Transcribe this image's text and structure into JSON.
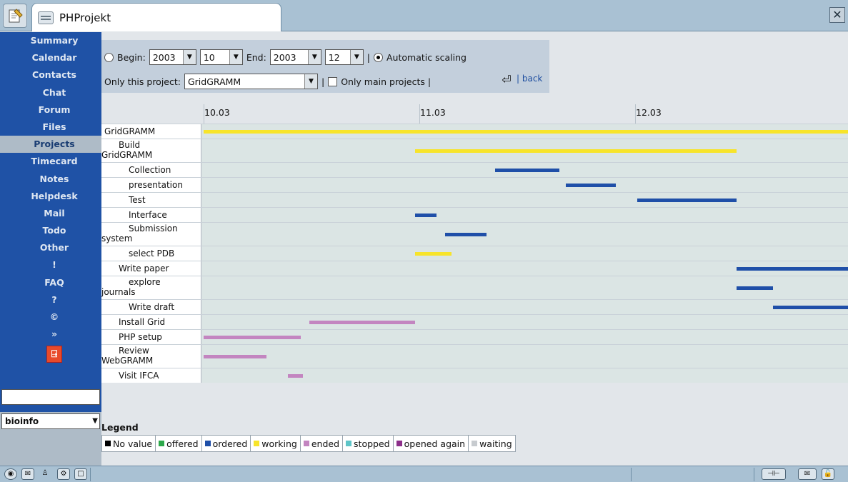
{
  "window": {
    "tab_title": "PHProjekt",
    "close_glyph": "✕"
  },
  "sidebar": {
    "items": [
      {
        "label": "Summary",
        "active": false
      },
      {
        "label": "Calendar",
        "active": false
      },
      {
        "label": "Contacts",
        "active": false
      },
      {
        "label": "Chat",
        "active": false
      },
      {
        "label": "Forum",
        "active": false
      },
      {
        "label": "Files",
        "active": false
      },
      {
        "label": "Projects",
        "active": true
      },
      {
        "label": "Timecard",
        "active": false
      },
      {
        "label": "Notes",
        "active": false
      },
      {
        "label": "Helpdesk",
        "active": false
      },
      {
        "label": "Mail",
        "active": false
      },
      {
        "label": "Todo",
        "active": false
      },
      {
        "label": "Other",
        "active": false
      },
      {
        "label": "!",
        "active": false
      },
      {
        "label": "FAQ",
        "active": false
      },
      {
        "label": "?",
        "active": false
      },
      {
        "label": "©",
        "active": false
      },
      {
        "label": "»",
        "active": false
      }
    ],
    "search_value": "",
    "group_select": "bioinfo"
  },
  "filter": {
    "begin_label": "Begin:",
    "begin_year": "2003",
    "begin_month": "10",
    "end_label": "End:",
    "end_year": "2003",
    "end_month": "12",
    "sep1": "|",
    "auto_scaling_label": "Automatic scaling",
    "auto_scaling_selected": true,
    "project_label": "Only this project:",
    "project_value": "GridGRAMM",
    "sep2": "|",
    "main_only_label": "Only main projects |",
    "main_only_checked": false,
    "back_label": "| back"
  },
  "gantt": {
    "months": [
      "10.03",
      "11.03",
      "12.03"
    ],
    "rows": [
      {
        "name_lines": [
          "GridGRAMM"
        ],
        "indent": 0,
        "start": 0.0,
        "end": 3.0,
        "status": "working"
      },
      {
        "name_lines": [
          "Build",
          "GridGRAMM"
        ],
        "indent": 1,
        "start": 0.98,
        "end": 2.47,
        "status": "working"
      },
      {
        "name_lines": [
          "Collection"
        ],
        "indent": 2,
        "start": 1.35,
        "end": 1.65,
        "status": "ordered"
      },
      {
        "name_lines": [
          "presentation"
        ],
        "indent": 2,
        "start": 1.68,
        "end": 1.91,
        "status": "ordered"
      },
      {
        "name_lines": [
          "Test"
        ],
        "indent": 2,
        "start": 2.01,
        "end": 2.47,
        "status": "ordered"
      },
      {
        "name_lines": [
          "Interface"
        ],
        "indent": 2,
        "start": 0.98,
        "end": 1.08,
        "status": "ordered"
      },
      {
        "name_lines": [
          "Submission",
          "system"
        ],
        "indent": 2,
        "start": 1.12,
        "end": 1.31,
        "status": "ordered"
      },
      {
        "name_lines": [
          "select PDB"
        ],
        "indent": 2,
        "start": 0.98,
        "end": 1.15,
        "status": "working"
      },
      {
        "name_lines": [
          "Write paper"
        ],
        "indent": 1,
        "start": 2.47,
        "end": 3.0,
        "status": "ordered"
      },
      {
        "name_lines": [
          "explore",
          "journals"
        ],
        "indent": 2,
        "start": 2.47,
        "end": 2.64,
        "status": "ordered"
      },
      {
        "name_lines": [
          "Write draft"
        ],
        "indent": 2,
        "start": 2.64,
        "end": 3.0,
        "status": "ordered"
      },
      {
        "name_lines": [
          "Install Grid"
        ],
        "indent": 1,
        "start": 0.49,
        "end": 0.98,
        "status": "ended"
      },
      {
        "name_lines": [
          "PHP setup"
        ],
        "indent": 1,
        "start": 0.0,
        "end": 0.45,
        "status": "ended"
      },
      {
        "name_lines": [
          "Review",
          "WebGRAMM"
        ],
        "indent": 1,
        "start": 0.0,
        "end": 0.29,
        "status": "ended"
      },
      {
        "name_lines": [
          "Visit IFCA"
        ],
        "indent": 1,
        "start": 0.39,
        "end": 0.46,
        "status": "ended"
      }
    ]
  },
  "legend": {
    "title": "Legend",
    "items": [
      {
        "label": "No value",
        "color": "#000000"
      },
      {
        "label": "offered",
        "color": "#2ca84a"
      },
      {
        "label": "ordered",
        "color": "#1f4fa8"
      },
      {
        "label": "working",
        "color": "#f7e42a"
      },
      {
        "label": "ended",
        "color": "#c385c0"
      },
      {
        "label": "stopped",
        "color": "#5ec5c8"
      },
      {
        "label": "opened again",
        "color": "#8d2f8a"
      },
      {
        "label": "waiting",
        "color": "#c7cbcf"
      }
    ]
  },
  "colors": {
    "sidebar_bg": "#1f52a6",
    "ordered": "#1f4fa8",
    "working": "#f7e42a",
    "ended": "#c385c0"
  }
}
